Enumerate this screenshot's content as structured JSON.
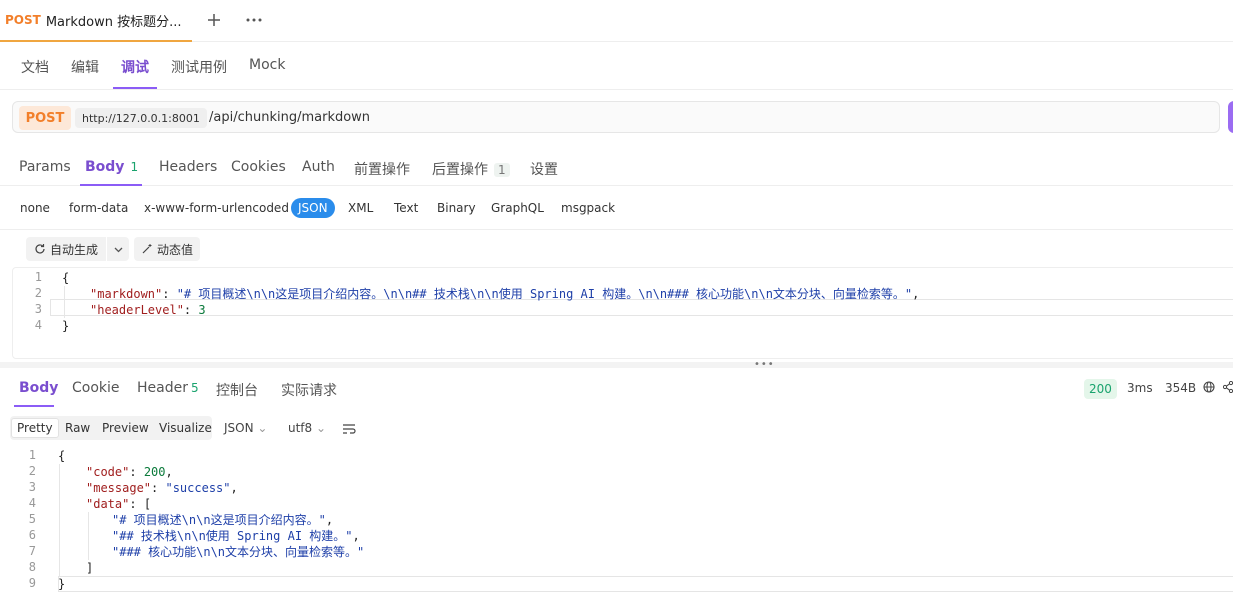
{
  "request_tab": {
    "method": "POST",
    "title": "Markdown 按标题分..."
  },
  "top_icons": {
    "add": "plus-icon",
    "more": "more-icon"
  },
  "sub_tabs": [
    "文档",
    "编辑",
    "调试",
    "测试用例",
    "Mock"
  ],
  "url": {
    "method": "POST",
    "host": "http://127.0.0.1:8001",
    "path": "/api/chunking/markdown"
  },
  "param_tabs": [
    {
      "label": "Params",
      "count": ""
    },
    {
      "label": "Body",
      "count": "1"
    },
    {
      "label": "Headers",
      "count": ""
    },
    {
      "label": "Cookies",
      "count": ""
    },
    {
      "label": "Auth",
      "count": ""
    },
    {
      "label": "前置操作",
      "count": ""
    },
    {
      "label": "后置操作",
      "count": "1"
    },
    {
      "label": "设置",
      "count": ""
    }
  ],
  "body_types": [
    "none",
    "form-data",
    "x-www-form-urlencoded",
    "JSON",
    "XML",
    "Text",
    "Binary",
    "GraphQL",
    "msgpack"
  ],
  "actions": {
    "auto_generate": "自动生成",
    "dynamic_value": "动态值"
  },
  "request_body": {
    "line_numbers": [
      "1",
      "2",
      "3",
      "4"
    ],
    "open": "{",
    "key_markdown": "\"markdown\"",
    "val_markdown": "\"# 项目概述\\n\\n这是项目介绍内容。\\n\\n## 技术栈\\n\\n使用 Spring AI 构建。\\n\\n### 核心功能\\n\\n文本分块、向量检索等。\"",
    "key_level": "\"headerLevel\"",
    "val_level": "3",
    "close": "}"
  },
  "response_tabs": [
    {
      "label": "Body",
      "count": ""
    },
    {
      "label": "Cookie",
      "count": ""
    },
    {
      "label": "Header",
      "count": "5"
    },
    {
      "label": "控制台",
      "count": ""
    },
    {
      "label": "实际请求",
      "count": ""
    }
  ],
  "response_meta": {
    "status": "200",
    "time": "3ms",
    "size": "354B"
  },
  "view_modes": [
    "Pretty",
    "Raw",
    "Preview",
    "Visualize"
  ],
  "format": {
    "type": "JSON",
    "encoding": "utf8"
  },
  "response_body": {
    "line_numbers": [
      "1",
      "2",
      "3",
      "4",
      "5",
      "6",
      "7",
      "8",
      "9"
    ],
    "open": "{",
    "key_code": "\"code\"",
    "val_code": "200",
    "key_message": "\"message\"",
    "val_message": "\"success\"",
    "key_data": "\"data\"",
    "arr_open": "[",
    "item1": "\"# 项目概述\\n\\n这是项目介绍内容。\"",
    "item2": "\"## 技术栈\\n\\n使用 Spring AI 构建。\"",
    "item3": "\"### 核心功能\\n\\n文本分块、向量检索等。\"",
    "arr_close": "]",
    "close": "}"
  },
  "colors": {
    "accent": "#8b5cf6",
    "method": "#f27f2a",
    "json_active": "#2a8ceb",
    "status_ok": "#1aa36e"
  }
}
